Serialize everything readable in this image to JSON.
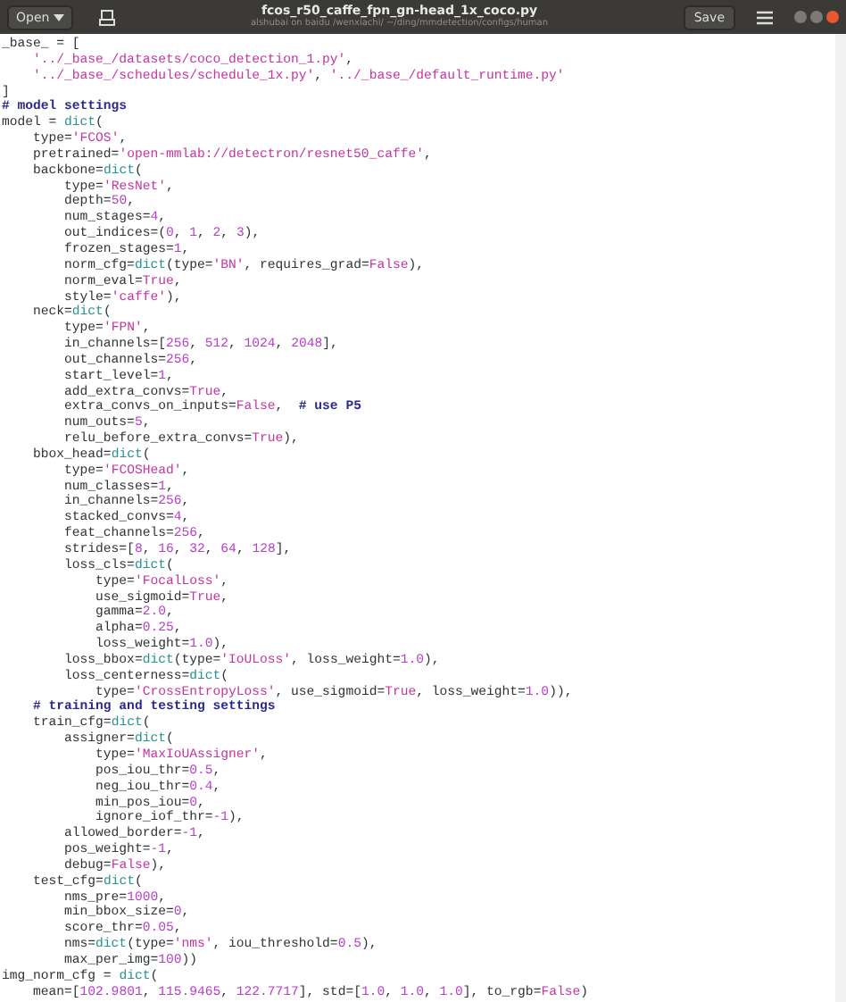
{
  "header": {
    "open_label": "Open",
    "title": "fcos_r50_caffe_fpn_gn-head_1x_coco.py",
    "subtitle": "alshubai on baidu /wenxiachi/ ~/ding/mmdetection/configs/human",
    "save_label": "Save"
  },
  "code": [
    [
      {
        "text": "_base_ = [",
        "kind": "plain"
      }
    ],
    [
      {
        "text": "    '../_base_/datasets/coco_detection_1.py'",
        "kind": "string"
      },
      {
        "text": ",",
        "kind": "plain"
      }
    ],
    [
      {
        "text": "    '../_base_/schedules/schedule_1x.py'",
        "kind": "string"
      },
      {
        "text": ", ",
        "kind": "plain"
      },
      {
        "text": "'../_base_/default_runtime.py'",
        "kind": "string"
      }
    ],
    [
      {
        "text": "]",
        "kind": "plain"
      }
    ],
    [
      {
        "text": "# model settings",
        "kind": "comment"
      }
    ],
    [
      {
        "text": "model = ",
        "kind": "plain"
      },
      {
        "text": "dict",
        "kind": "builtin"
      },
      {
        "text": "(",
        "kind": "plain"
      }
    ],
    [
      {
        "text": "    type=",
        "kind": "plain"
      },
      {
        "text": "'FCOS'",
        "kind": "string"
      },
      {
        "text": ",",
        "kind": "plain"
      }
    ],
    [
      {
        "text": "    pretrained=",
        "kind": "plain"
      },
      {
        "text": "'open-mmlab://detectron/resnet50_caffe'",
        "kind": "string"
      },
      {
        "text": ",",
        "kind": "plain"
      }
    ],
    [
      {
        "text": "    backbone=",
        "kind": "plain"
      },
      {
        "text": "dict",
        "kind": "builtin"
      },
      {
        "text": "(",
        "kind": "plain"
      }
    ],
    [
      {
        "text": "        type=",
        "kind": "plain"
      },
      {
        "text": "'ResNet'",
        "kind": "string"
      },
      {
        "text": ",",
        "kind": "plain"
      }
    ],
    [
      {
        "text": "        depth=",
        "kind": "plain"
      },
      {
        "text": "50",
        "kind": "number"
      },
      {
        "text": ",",
        "kind": "plain"
      }
    ],
    [
      {
        "text": "        num_stages=",
        "kind": "plain"
      },
      {
        "text": "4",
        "kind": "number"
      },
      {
        "text": ",",
        "kind": "plain"
      }
    ],
    [
      {
        "text": "        out_indices=(",
        "kind": "plain"
      },
      {
        "text": "0",
        "kind": "number"
      },
      {
        "text": ", ",
        "kind": "plain"
      },
      {
        "text": "1",
        "kind": "number"
      },
      {
        "text": ", ",
        "kind": "plain"
      },
      {
        "text": "2",
        "kind": "number"
      },
      {
        "text": ", ",
        "kind": "plain"
      },
      {
        "text": "3",
        "kind": "number"
      },
      {
        "text": "),",
        "kind": "plain"
      }
    ],
    [
      {
        "text": "        frozen_stages=",
        "kind": "plain"
      },
      {
        "text": "1",
        "kind": "number"
      },
      {
        "text": ",",
        "kind": "plain"
      }
    ],
    [
      {
        "text": "        norm_cfg=",
        "kind": "plain"
      },
      {
        "text": "dict",
        "kind": "builtin"
      },
      {
        "text": "(type=",
        "kind": "plain"
      },
      {
        "text": "'BN'",
        "kind": "string"
      },
      {
        "text": ", requires_grad=",
        "kind": "plain"
      },
      {
        "text": "False",
        "kind": "constant"
      },
      {
        "text": "),",
        "kind": "plain"
      }
    ],
    [
      {
        "text": "        norm_eval=",
        "kind": "plain"
      },
      {
        "text": "True",
        "kind": "constant"
      },
      {
        "text": ",",
        "kind": "plain"
      }
    ],
    [
      {
        "text": "        style=",
        "kind": "plain"
      },
      {
        "text": "'caffe'",
        "kind": "string"
      },
      {
        "text": "),",
        "kind": "plain"
      }
    ],
    [
      {
        "text": "    neck=",
        "kind": "plain"
      },
      {
        "text": "dict",
        "kind": "builtin"
      },
      {
        "text": "(",
        "kind": "plain"
      }
    ],
    [
      {
        "text": "        type=",
        "kind": "plain"
      },
      {
        "text": "'FPN'",
        "kind": "string"
      },
      {
        "text": ",",
        "kind": "plain"
      }
    ],
    [
      {
        "text": "        in_channels=[",
        "kind": "plain"
      },
      {
        "text": "256",
        "kind": "number"
      },
      {
        "text": ", ",
        "kind": "plain"
      },
      {
        "text": "512",
        "kind": "number"
      },
      {
        "text": ", ",
        "kind": "plain"
      },
      {
        "text": "1024",
        "kind": "number"
      },
      {
        "text": ", ",
        "kind": "plain"
      },
      {
        "text": "2048",
        "kind": "number"
      },
      {
        "text": "],",
        "kind": "plain"
      }
    ],
    [
      {
        "text": "        out_channels=",
        "kind": "plain"
      },
      {
        "text": "256",
        "kind": "number"
      },
      {
        "text": ",",
        "kind": "plain"
      }
    ],
    [
      {
        "text": "        start_level=",
        "kind": "plain"
      },
      {
        "text": "1",
        "kind": "number"
      },
      {
        "text": ",",
        "kind": "plain"
      }
    ],
    [
      {
        "text": "        add_extra_convs=",
        "kind": "plain"
      },
      {
        "text": "True",
        "kind": "constant"
      },
      {
        "text": ",",
        "kind": "plain"
      }
    ],
    [
      {
        "text": "        extra_convs_on_inputs=",
        "kind": "plain"
      },
      {
        "text": "False",
        "kind": "constant"
      },
      {
        "text": ",  ",
        "kind": "plain"
      },
      {
        "text": "# use P5",
        "kind": "comment"
      }
    ],
    [
      {
        "text": "        num_outs=",
        "kind": "plain"
      },
      {
        "text": "5",
        "kind": "number"
      },
      {
        "text": ",",
        "kind": "plain"
      }
    ],
    [
      {
        "text": "        relu_before_extra_convs=",
        "kind": "plain"
      },
      {
        "text": "True",
        "kind": "constant"
      },
      {
        "text": "),",
        "kind": "plain"
      }
    ],
    [
      {
        "text": "    bbox_head=",
        "kind": "plain"
      },
      {
        "text": "dict",
        "kind": "builtin"
      },
      {
        "text": "(",
        "kind": "plain"
      }
    ],
    [
      {
        "text": "        type=",
        "kind": "plain"
      },
      {
        "text": "'FCOSHead'",
        "kind": "string"
      },
      {
        "text": ",",
        "kind": "plain"
      }
    ],
    [
      {
        "text": "        num_classes=",
        "kind": "plain"
      },
      {
        "text": "1",
        "kind": "number"
      },
      {
        "text": ",",
        "kind": "plain"
      }
    ],
    [
      {
        "text": "        in_channels=",
        "kind": "plain"
      },
      {
        "text": "256",
        "kind": "number"
      },
      {
        "text": ",",
        "kind": "plain"
      }
    ],
    [
      {
        "text": "        stacked_convs=",
        "kind": "plain"
      },
      {
        "text": "4",
        "kind": "number"
      },
      {
        "text": ",",
        "kind": "plain"
      }
    ],
    [
      {
        "text": "        feat_channels=",
        "kind": "plain"
      },
      {
        "text": "256",
        "kind": "number"
      },
      {
        "text": ",",
        "kind": "plain"
      }
    ],
    [
      {
        "text": "        strides=[",
        "kind": "plain"
      },
      {
        "text": "8",
        "kind": "number"
      },
      {
        "text": ", ",
        "kind": "plain"
      },
      {
        "text": "16",
        "kind": "number"
      },
      {
        "text": ", ",
        "kind": "plain"
      },
      {
        "text": "32",
        "kind": "number"
      },
      {
        "text": ", ",
        "kind": "plain"
      },
      {
        "text": "64",
        "kind": "number"
      },
      {
        "text": ", ",
        "kind": "plain"
      },
      {
        "text": "128",
        "kind": "number"
      },
      {
        "text": "],",
        "kind": "plain"
      }
    ],
    [
      {
        "text": "        loss_cls=",
        "kind": "plain"
      },
      {
        "text": "dict",
        "kind": "builtin"
      },
      {
        "text": "(",
        "kind": "plain"
      }
    ],
    [
      {
        "text": "            type=",
        "kind": "plain"
      },
      {
        "text": "'FocalLoss'",
        "kind": "string"
      },
      {
        "text": ",",
        "kind": "plain"
      }
    ],
    [
      {
        "text": "            use_sigmoid=",
        "kind": "plain"
      },
      {
        "text": "True",
        "kind": "constant"
      },
      {
        "text": ",",
        "kind": "plain"
      }
    ],
    [
      {
        "text": "            gamma=",
        "kind": "plain"
      },
      {
        "text": "2.0",
        "kind": "number"
      },
      {
        "text": ",",
        "kind": "plain"
      }
    ],
    [
      {
        "text": "            alpha=",
        "kind": "plain"
      },
      {
        "text": "0.25",
        "kind": "number"
      },
      {
        "text": ",",
        "kind": "plain"
      }
    ],
    [
      {
        "text": "            loss_weight=",
        "kind": "plain"
      },
      {
        "text": "1.0",
        "kind": "number"
      },
      {
        "text": "),",
        "kind": "plain"
      }
    ],
    [
      {
        "text": "        loss_bbox=",
        "kind": "plain"
      },
      {
        "text": "dict",
        "kind": "builtin"
      },
      {
        "text": "(type=",
        "kind": "plain"
      },
      {
        "text": "'IoULoss'",
        "kind": "string"
      },
      {
        "text": ", loss_weight=",
        "kind": "plain"
      },
      {
        "text": "1.0",
        "kind": "number"
      },
      {
        "text": "),",
        "kind": "plain"
      }
    ],
    [
      {
        "text": "        loss_centerness=",
        "kind": "plain"
      },
      {
        "text": "dict",
        "kind": "builtin"
      },
      {
        "text": "(",
        "kind": "plain"
      }
    ],
    [
      {
        "text": "            type=",
        "kind": "plain"
      },
      {
        "text": "'CrossEntropyLoss'",
        "kind": "string"
      },
      {
        "text": ", use_sigmoid=",
        "kind": "plain"
      },
      {
        "text": "True",
        "kind": "constant"
      },
      {
        "text": ", loss_weight=",
        "kind": "plain"
      },
      {
        "text": "1.0",
        "kind": "number"
      },
      {
        "text": ")),",
        "kind": "plain"
      }
    ],
    [
      {
        "text": "    # training and testing settings",
        "kind": "comment"
      }
    ],
    [
      {
        "text": "    train_cfg=",
        "kind": "plain"
      },
      {
        "text": "dict",
        "kind": "builtin"
      },
      {
        "text": "(",
        "kind": "plain"
      }
    ],
    [
      {
        "text": "        assigner=",
        "kind": "plain"
      },
      {
        "text": "dict",
        "kind": "builtin"
      },
      {
        "text": "(",
        "kind": "plain"
      }
    ],
    [
      {
        "text": "            type=",
        "kind": "plain"
      },
      {
        "text": "'MaxIoUAssigner'",
        "kind": "string"
      },
      {
        "text": ",",
        "kind": "plain"
      }
    ],
    [
      {
        "text": "            pos_iou_thr=",
        "kind": "plain"
      },
      {
        "text": "0.5",
        "kind": "number"
      },
      {
        "text": ",",
        "kind": "plain"
      }
    ],
    [
      {
        "text": "            neg_iou_thr=",
        "kind": "plain"
      },
      {
        "text": "0.4",
        "kind": "number"
      },
      {
        "text": ",",
        "kind": "plain"
      }
    ],
    [
      {
        "text": "            min_pos_iou=",
        "kind": "plain"
      },
      {
        "text": "0",
        "kind": "number"
      },
      {
        "text": ",",
        "kind": "plain"
      }
    ],
    [
      {
        "text": "            ignore_iof_thr=",
        "kind": "plain"
      },
      {
        "text": "-1",
        "kind": "number"
      },
      {
        "text": "),",
        "kind": "plain"
      }
    ],
    [
      {
        "text": "        allowed_border=",
        "kind": "plain"
      },
      {
        "text": "-1",
        "kind": "number"
      },
      {
        "text": ",",
        "kind": "plain"
      }
    ],
    [
      {
        "text": "        pos_weight=",
        "kind": "plain"
      },
      {
        "text": "-1",
        "kind": "number"
      },
      {
        "text": ",",
        "kind": "plain"
      }
    ],
    [
      {
        "text": "        debug=",
        "kind": "plain"
      },
      {
        "text": "False",
        "kind": "constant"
      },
      {
        "text": "),",
        "kind": "plain"
      }
    ],
    [
      {
        "text": "    test_cfg=",
        "kind": "plain"
      },
      {
        "text": "dict",
        "kind": "builtin"
      },
      {
        "text": "(",
        "kind": "plain"
      }
    ],
    [
      {
        "text": "        nms_pre=",
        "kind": "plain"
      },
      {
        "text": "1000",
        "kind": "number"
      },
      {
        "text": ",",
        "kind": "plain"
      }
    ],
    [
      {
        "text": "        min_bbox_size=",
        "kind": "plain"
      },
      {
        "text": "0",
        "kind": "number"
      },
      {
        "text": ",",
        "kind": "plain"
      }
    ],
    [
      {
        "text": "        score_thr=",
        "kind": "plain"
      },
      {
        "text": "0.05",
        "kind": "number"
      },
      {
        "text": ",",
        "kind": "plain"
      }
    ],
    [
      {
        "text": "        nms=",
        "kind": "plain"
      },
      {
        "text": "dict",
        "kind": "builtin"
      },
      {
        "text": "(type=",
        "kind": "plain"
      },
      {
        "text": "'nms'",
        "kind": "string"
      },
      {
        "text": ", iou_threshold=",
        "kind": "plain"
      },
      {
        "text": "0.5",
        "kind": "number"
      },
      {
        "text": "),",
        "kind": "plain"
      }
    ],
    [
      {
        "text": "        max_per_img=",
        "kind": "plain"
      },
      {
        "text": "100",
        "kind": "number"
      },
      {
        "text": "))",
        "kind": "plain"
      }
    ],
    [
      {
        "text": "img_norm_cfg = ",
        "kind": "plain"
      },
      {
        "text": "dict",
        "kind": "builtin"
      },
      {
        "text": "(",
        "kind": "plain"
      }
    ],
    [
      {
        "text": "    mean=[",
        "kind": "plain"
      },
      {
        "text": "102.9801",
        "kind": "number"
      },
      {
        "text": ", ",
        "kind": "plain"
      },
      {
        "text": "115.9465",
        "kind": "number"
      },
      {
        "text": ", ",
        "kind": "plain"
      },
      {
        "text": "122.7717",
        "kind": "number"
      },
      {
        "text": "], std=[",
        "kind": "plain"
      },
      {
        "text": "1.0",
        "kind": "number"
      },
      {
        "text": ", ",
        "kind": "plain"
      },
      {
        "text": "1.0",
        "kind": "number"
      },
      {
        "text": ", ",
        "kind": "plain"
      },
      {
        "text": "1.0",
        "kind": "number"
      },
      {
        "text": "], to_rgb=",
        "kind": "plain"
      },
      {
        "text": "False",
        "kind": "constant"
      },
      {
        "text": ")",
        "kind": "plain"
      }
    ]
  ]
}
